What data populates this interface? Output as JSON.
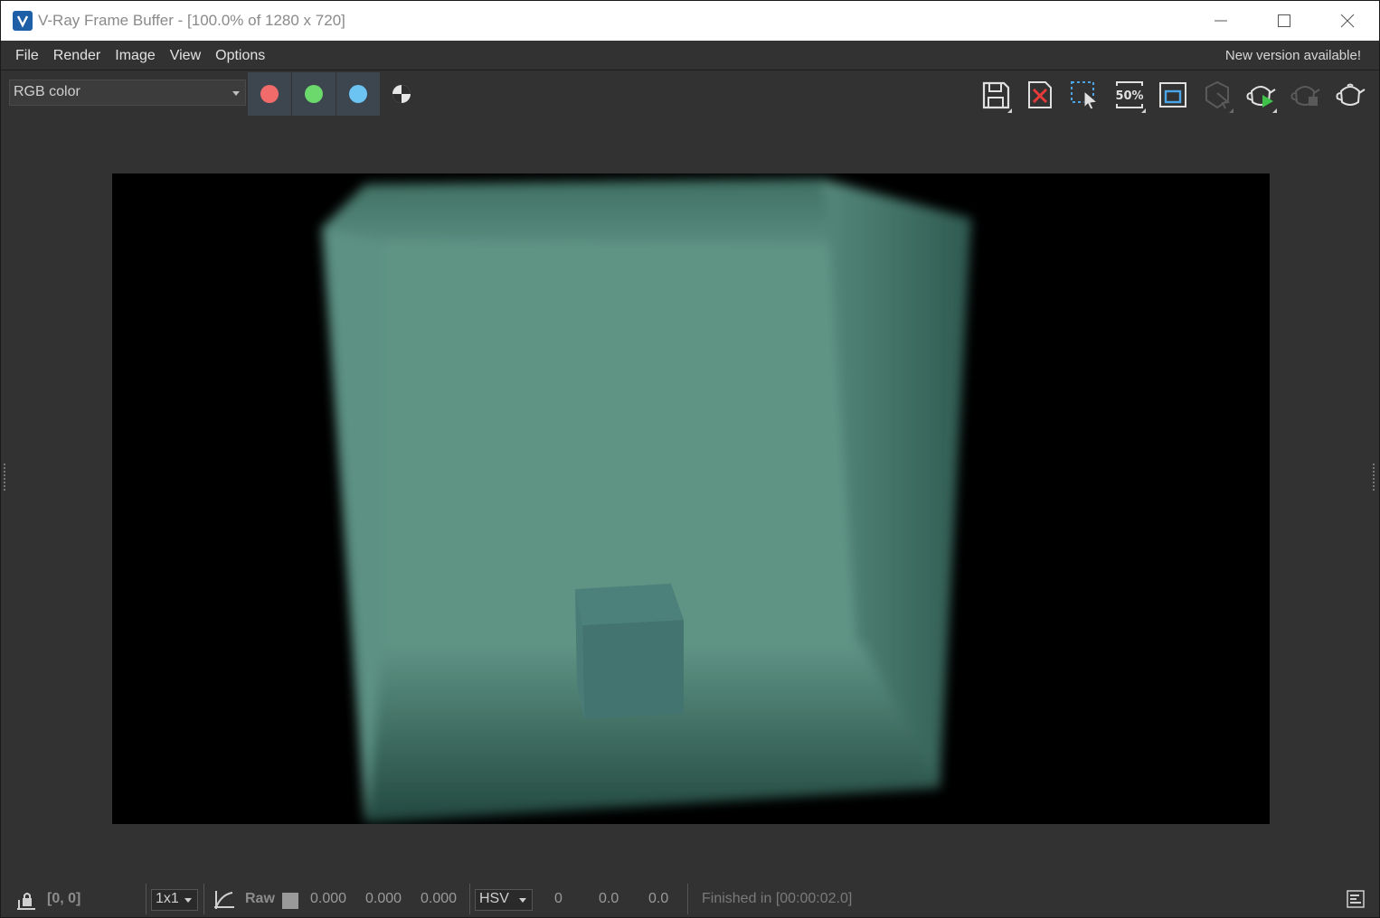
{
  "window": {
    "title": "V-Ray Frame Buffer - [100.0% of 1280 x 720]"
  },
  "menu": {
    "items": [
      "File",
      "Render",
      "Image",
      "View",
      "Options"
    ],
    "notice": "New version available!"
  },
  "toolbar": {
    "channel_value": "RGB color",
    "channel_buttons": [
      {
        "name": "red-channel",
        "color": "#f26b6b"
      },
      {
        "name": "green-channel",
        "color": "#6bd96b"
      },
      {
        "name": "blue-channel",
        "color": "#6bc4f2"
      }
    ],
    "icons": [
      "save-icon",
      "clear-image-icon",
      "region-render-icon",
      "zoom-50-icon",
      "frame-icon",
      "track-mouse-icon",
      "render-interactive-icon",
      "stop-render-icon",
      "render-icon"
    ],
    "zoom_label": "50%"
  },
  "status": {
    "coords": "[0, 0]",
    "sample_size": "1x1",
    "mode": "Raw",
    "rgb": [
      "0.000",
      "0.000",
      "0.000"
    ],
    "color_space": "HSV",
    "hsv": [
      "0",
      "0.0",
      "0.0"
    ],
    "message": "Finished in [00:00:02.0]"
  },
  "colors": {
    "scene_box": "#5f9485",
    "small_cube": "#4a7a78",
    "background": "#000000"
  }
}
